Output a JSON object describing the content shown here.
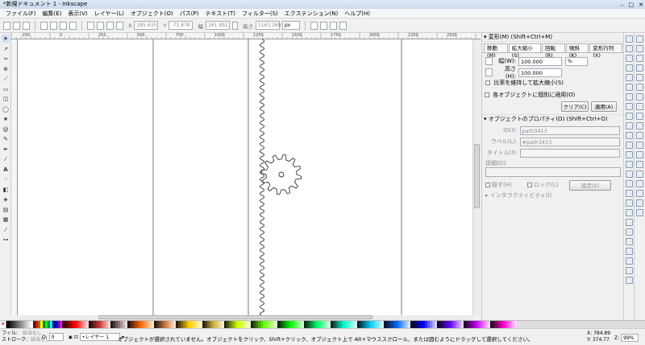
{
  "window": {
    "title": "*新規ドキュメント 1 - Inkscape",
    "controls": [
      "–",
      "□",
      "✕"
    ]
  },
  "menu": [
    "ファイル(F)",
    "編集(E)",
    "表示(V)",
    "レイヤー(L)",
    "オブジェクト(O)",
    "パス(P)",
    "テキスト(T)",
    "フィルター(S)",
    "エクステンション(N)",
    "ヘルプ(H)"
  ],
  "toolbar": {
    "x_label": "X",
    "x_value": "285.635",
    "y_label": "Y",
    "y_value": "-71.878",
    "w_label": "幅",
    "w_value": "161.992",
    "h_label": "高さ",
    "h_value": "1163.269",
    "unit": "px"
  },
  "ruler": {
    "ticks": [
      "-250",
      "0",
      "250",
      "500",
      "750",
      "1000",
      "1250",
      "1500",
      "1750",
      "2000",
      "2250",
      "2500"
    ]
  },
  "transform_panel": {
    "title": "変形(M) (Shift+Ctrl+M)",
    "tabs": [
      "移動(M)",
      "拡大縮小(S)",
      "回転(R)",
      "傾斜(K)",
      "変形行列(X)"
    ],
    "active_tab": 1,
    "width_label": "幅(W):",
    "width_value": "100.000",
    "unit": "%",
    "height_label": "高さ(H):",
    "height_value": "100.000",
    "keep_ratio": "比率を維持して拡大縮小(S)",
    "apply_each": "各オブジェクトに個別に適用(O)",
    "clear_button": "クリア(C)",
    "apply_button": "適用(A)"
  },
  "object_panel": {
    "title": "オブジェクトのプロパティ(O) (Shift+Ctrl+O)",
    "id_label": "ID(I):",
    "id_value": "path3413",
    "label_label": "ラベル(L):",
    "label_value": "#path3413",
    "title_label": "タイトル(I):",
    "title_value": "",
    "desc_label": "詳細(D):",
    "hide": "隠す(H)",
    "lock": "ロック(L)",
    "set_button": "設定(S)",
    "interactivity": "インタラクティビティ(I)"
  },
  "status": {
    "fill_label": "フィル:",
    "fill_value": "該当なし",
    "stroke_label": "ストローク:",
    "stroke_value": "該当なし",
    "opacity_label": "O:",
    "opacity_value": "0",
    "layer": "•レイヤー 1",
    "message": "オブジェクトが選択されていません。オブジェクトをクリック、Shift+クリック、オブジェクト上で Alt+マウススクロール、または囲むようにドラッグして選択してください。",
    "x_label": "X:",
    "x_value": "784.89",
    "y_label": "Y:",
    "y_value": "374.77",
    "z_label": "Z:",
    "z_value": "99%"
  },
  "palette_colors": [
    "#000000",
    "#1a1a1a",
    "#333333",
    "#4d4d4d",
    "#666666",
    "#808080",
    "#999999",
    "#b3b3b3",
    "#cccccc",
    "#e6e6e6",
    "#ffffff",
    "#800000",
    "#ff0000",
    "#808000",
    "#ffff00",
    "#008000",
    "#00ff00",
    "#008080",
    "#00ffff",
    "#000080",
    "#0000ff",
    "#800080",
    "#ff00ff",
    "#2b0000",
    "#550000",
    "#800000",
    "#aa0000",
    "#d40000",
    "#ff0000",
    "#ff2a2a",
    "#ff5555",
    "#ff8080",
    "#ffaaaa",
    "#ffd5d5",
    "#280b0b",
    "#501616",
    "#782121",
    "#a02c2c",
    "#c83737",
    "#d35f5f",
    "#de8787",
    "#e9afaf",
    "#f4d7d7",
    "#241c1c",
    "#483737",
    "#6c5353",
    "#916f6f",
    "#ac9393",
    "#c8b7b7",
    "#e3dbdb",
    "#2b1100",
    "#552200",
    "#803300",
    "#aa4400",
    "#d45500",
    "#ff6600",
    "#ff7f2a",
    "#ff9955",
    "#ffb380",
    "#ffccaa",
    "#ffe6d5",
    "#28170b",
    "#502d16",
    "#784421",
    "#a05a2c",
    "#c87137",
    "#d38d5f",
    "#deaa87",
    "#e9c6af",
    "#f4e3d7",
    "#2b2200",
    "#554400",
    "#806600",
    "#aa8800",
    "#d4aa00",
    "#ffcc00",
    "#ffd42a",
    "#ffdd55",
    "#ffe680",
    "#ffeeaa",
    "#fff6d5",
    "#282208",
    "#504416",
    "#786721",
    "#a0892c",
    "#c8ab37",
    "#d3bc5f",
    "#decd87",
    "#e9ddaf",
    "#f4eed7",
    "#222b00",
    "#445500",
    "#668000",
    "#88aa00",
    "#aad400",
    "#ccff00",
    "#d4ff2a",
    "#ddff55",
    "#e5ff80",
    "#eeffaa",
    "#f6ffd5",
    "#112b00",
    "#225500",
    "#338000",
    "#44aa00",
    "#55d400",
    "#66ff00",
    "#7fff2a",
    "#99ff55",
    "#b3ff80",
    "#ccffaa",
    "#e5ffd5",
    "#002b00",
    "#005500",
    "#008000",
    "#00aa00",
    "#00d400",
    "#00ff00",
    "#2aff2a",
    "#55ff55",
    "#80ff80",
    "#aaffaa",
    "#d5ffd5",
    "#002b11",
    "#005522",
    "#008033",
    "#00aa44",
    "#00d455",
    "#00ff66",
    "#2aff80",
    "#55ff99",
    "#80ffb3",
    "#aaffcc",
    "#d5ffe6",
    "#002b22",
    "#005544",
    "#008066",
    "#00aa88",
    "#00d4aa",
    "#00ffcc",
    "#2affd5",
    "#55ffdd",
    "#80ffe6",
    "#aaffee",
    "#d5fff6",
    "#00222b",
    "#004455",
    "#006680",
    "#0088aa",
    "#00aad4",
    "#00ccff",
    "#2ad4ff",
    "#55ddff",
    "#80e5ff",
    "#aaeeff",
    "#d5f6ff",
    "#00112b",
    "#002255",
    "#003380",
    "#0044aa",
    "#0055d4",
    "#0066ff",
    "#2a7fff",
    "#5599ff",
    "#80b3ff",
    "#aaccff",
    "#d5e5ff",
    "#00002b",
    "#000055",
    "#000080",
    "#0000aa",
    "#0000d4",
    "#0000ff",
    "#2a2aff",
    "#5555ff",
    "#8080ff",
    "#aaaaff",
    "#d5d5ff",
    "#11002b",
    "#220055",
    "#330080",
    "#4400aa",
    "#5500d4",
    "#6600ff",
    "#7f2aff",
    "#9955ff",
    "#b380ff",
    "#ccaaff",
    "#e5d5ff",
    "#22002b",
    "#440055",
    "#660080",
    "#8800aa",
    "#aa00d4",
    "#cc00ff",
    "#d42aff",
    "#dd55ff",
    "#e580ff",
    "#eeaaff",
    "#f6d5ff",
    "#2b0022",
    "#550044",
    "#800066",
    "#aa0088",
    "#d400aa",
    "#ff00cc",
    "#ff2ad4",
    "#ff55dd",
    "#ff80e5",
    "#ffaaee",
    "#ffd5f6"
  ]
}
